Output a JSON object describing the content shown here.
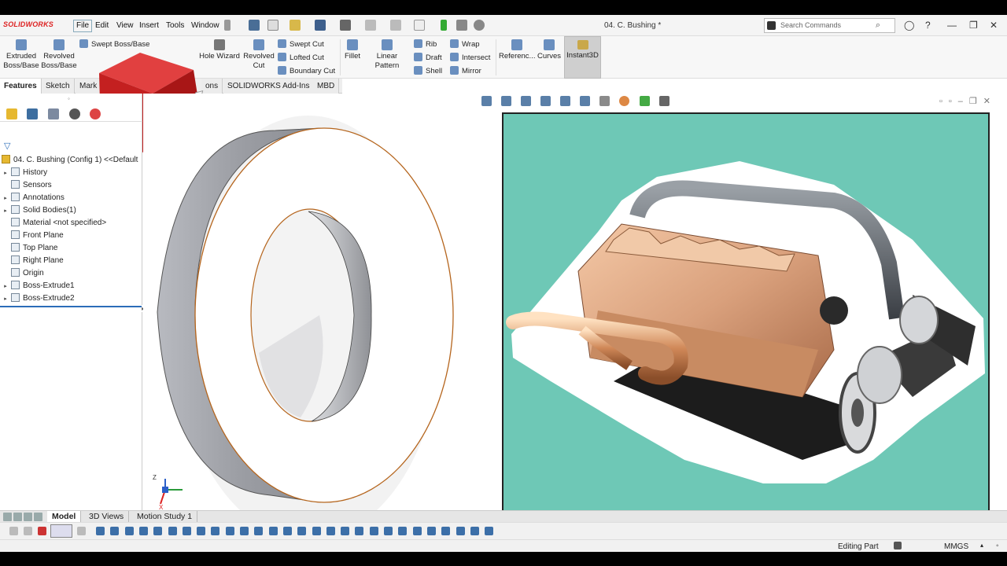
{
  "app": {
    "logo_text": "SOLIDWORKS",
    "document_title": "04. C. Bushing *",
    "search_placeholder": "Search Commands"
  },
  "menu": [
    "File",
    "Edit",
    "View",
    "Insert",
    "Tools",
    "Window"
  ],
  "command_manager": {
    "extruded_boss": "Extruded Boss/Base",
    "revolved_boss": "Revolved Boss/Base",
    "swept_boss": "Swept Boss/Base",
    "hole_wizard": "Hole Wizard",
    "revolved_cut": "Revolved Cut",
    "swept_cut": "Swept Cut",
    "lofted_cut": "Lofted Cut",
    "boundary_cut": "Boundary Cut",
    "fillet": "Fillet",
    "linear_pattern": "Linear Pattern",
    "rib": "Rib",
    "draft": "Draft",
    "shell": "Shell",
    "wrap": "Wrap",
    "intersect": "Intersect",
    "mirror": "Mirror",
    "reference": "Referenc...",
    "curves": "Curves",
    "instant3d": "Instant3D"
  },
  "cm_tabs": [
    "Features",
    "Sketch",
    "Mark",
    "ons",
    "SOLIDWORKS Add-Ins",
    "MBD"
  ],
  "feature_tree": {
    "root": "04. C. Bushing  (Config 1) <<Default",
    "items": [
      {
        "label": "History",
        "expandable": true
      },
      {
        "label": "Sensors",
        "expandable": false
      },
      {
        "label": "Annotations",
        "expandable": true
      },
      {
        "label": "Solid Bodies(1)",
        "expandable": true
      },
      {
        "label": "Material <not specified>",
        "expandable": false
      },
      {
        "label": "Front Plane",
        "expandable": false
      },
      {
        "label": "Top Plane",
        "expandable": false
      },
      {
        "label": "Right Plane",
        "expandable": false
      },
      {
        "label": "Origin",
        "expandable": false
      },
      {
        "label": "Boss-Extrude1",
        "expandable": true
      },
      {
        "label": "Boss-Extrude2",
        "expandable": true
      }
    ]
  },
  "triad": {
    "z": "Z",
    "x": "X"
  },
  "bottom_tabs": [
    "Model",
    "3D Views",
    "Motion Study 1"
  ],
  "status": {
    "mode": "Editing Part",
    "units": "MMGS"
  },
  "colors": {
    "accent_red": "#d42a2a",
    "engine_bg": "#6ec8b6",
    "selection_blue": "#2b6cb8"
  }
}
